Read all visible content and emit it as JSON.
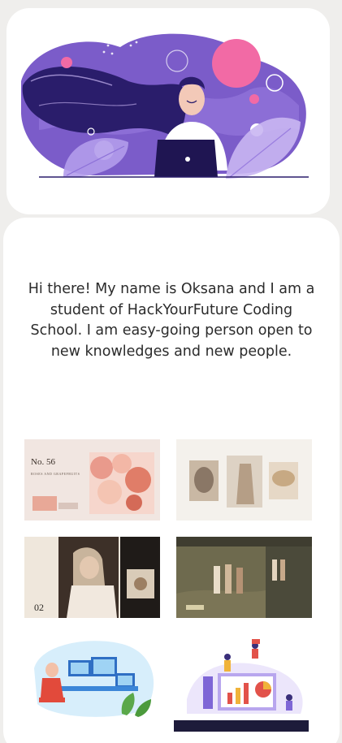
{
  "hero": {
    "illustration": "woman-with-laptop-illustration",
    "colors": {
      "purple": "#7b5cc9",
      "navy": "#2a1d6b",
      "pink": "#f26aa5",
      "lilac": "#c9b6f2"
    }
  },
  "about": {
    "intro_text": "Hi there! My name is Oksana and I am a student of HackYourFuture Coding School. I am easy-going person open to new knowledges and new people."
  },
  "portfolio": [
    {
      "name": "arta-flowers-project",
      "title": "No. 56",
      "subtitle": "ROSES AND GRAPEFRUITS"
    },
    {
      "name": "arta-fashion-gallery-project"
    },
    {
      "name": "arta-woman-reading-project",
      "number": "02"
    },
    {
      "name": "arta-field-walk-project"
    },
    {
      "name": "developer-workstation-illustration"
    },
    {
      "name": "data-analytics-illustration"
    }
  ]
}
